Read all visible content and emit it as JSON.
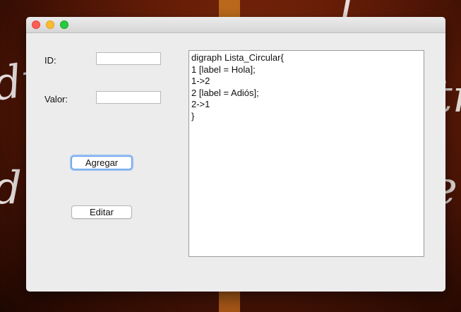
{
  "window": {
    "id_label": "ID:",
    "id_value": "",
    "valor_label": "Valor:",
    "valor_value": "",
    "add_button": "Agregar",
    "edit_button": "Editar",
    "textarea_lines": [
      "digraph Lista_Circular{",
      "1 [label = Hola];",
      "1->2",
      "2 [label = Adiós];",
      "2->1",
      "}"
    ]
  },
  "desktop": {
    "stripe_color": "#e59a35"
  }
}
